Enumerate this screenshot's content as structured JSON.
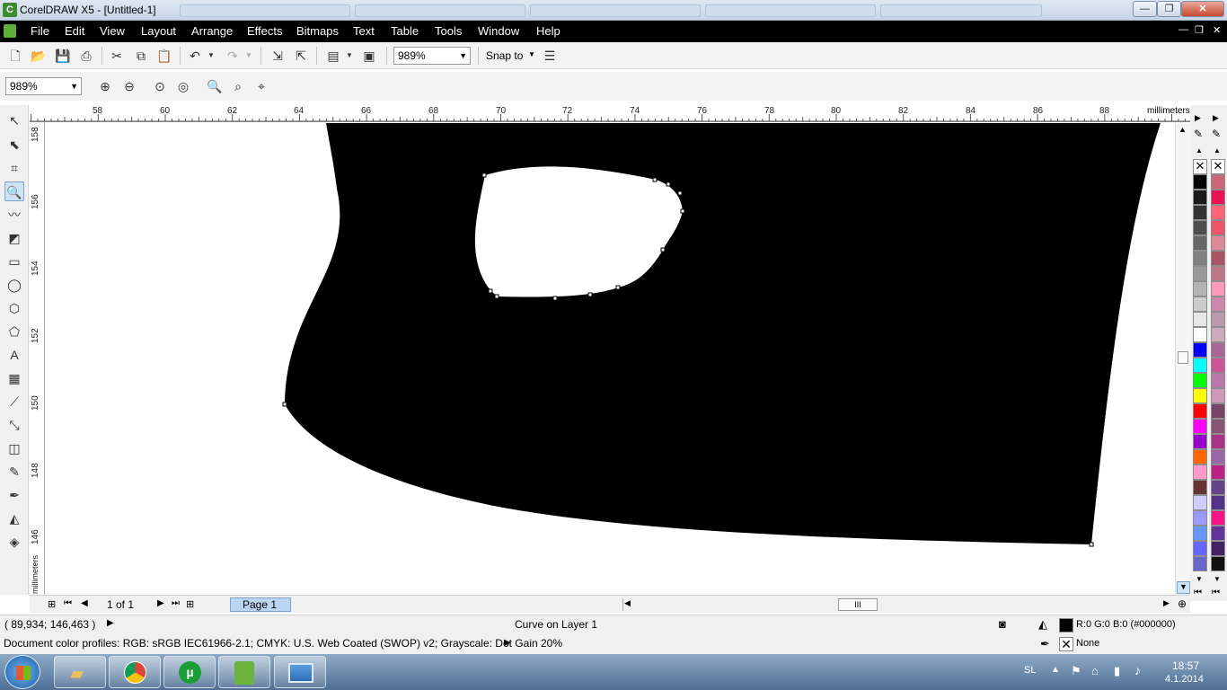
{
  "window": {
    "title": "CorelDRAW X5 - [Untitled-1]",
    "minimize": "—",
    "maximize": "❐",
    "close": "✕"
  },
  "menubar": {
    "items": [
      "File",
      "Edit",
      "View",
      "Layout",
      "Arrange",
      "Effects",
      "Bitmaps",
      "Text",
      "Table",
      "Tools",
      "Window",
      "Help"
    ],
    "mdi_min": "—",
    "mdi_restore": "❐",
    "mdi_close": "✕"
  },
  "toolbar": {
    "zoom_level": "989%",
    "snap_to": "Snap to"
  },
  "propertybar": {
    "zoom_level": "989%"
  },
  "ruler": {
    "unit": "millimeters",
    "h_ticks": [
      "58",
      "60",
      "62",
      "64",
      "66",
      "68",
      "70",
      "72",
      "74",
      "76",
      "78",
      "80",
      "82",
      "84",
      "86",
      "88"
    ],
    "v_ticks": [
      "158",
      "156",
      "154",
      "152",
      "150",
      "148",
      "146"
    ],
    "v_unit": "millimeters"
  },
  "pagebar": {
    "page_count": "1 of 1",
    "page_tab": "Page 1"
  },
  "status": {
    "coords": "( 89,934; 146,463 )",
    "object_info": "Curve on Layer 1",
    "fill_info": "R:0 G:0 B:0 (#000000)",
    "outline_info": "None",
    "color_profiles": "Document color profiles: RGB: sRGB IEC61966-2.1; CMYK: U.S. Web Coated (SWOP) v2; Grayscale: Dot Gain 20%"
  },
  "palette": {
    "left_colors": [
      "#000000",
      "#1a1a1a",
      "#333333",
      "#4d4d4d",
      "#666666",
      "#808080",
      "#999999",
      "#b3b3b3",
      "#cccccc",
      "#e6e6e6",
      "#ffffff",
      "#0000ff",
      "#00ffff",
      "#00ff00",
      "#ffff00",
      "#ff0000",
      "#ff00ff",
      "#9900cc",
      "#ff6600",
      "#ff99cc",
      "#663333",
      "#ccccff",
      "#9999ff",
      "#6699ff",
      "#6666ff",
      "#6666cc"
    ],
    "right_colors": [
      "#cc6677",
      "#ee1155",
      "#ff6677",
      "#ee5566",
      "#dd8899",
      "#aa5566",
      "#bb7788",
      "#ff99bb",
      "#cc88aa",
      "#bb99aa",
      "#ccaabb",
      "#aa6699",
      "#cc5599",
      "#bb77aa",
      "#cc99bb",
      "#774466",
      "#885577",
      "#aa3388",
      "#9966aa",
      "#bb2288",
      "#664488",
      "#553388",
      "#ff1188",
      "#663399",
      "#442266",
      "#111111"
    ],
    "fill_swatch": "#000000"
  },
  "taskbar": {
    "language": "SL",
    "time": "18:57",
    "date": "4.1.2014"
  }
}
